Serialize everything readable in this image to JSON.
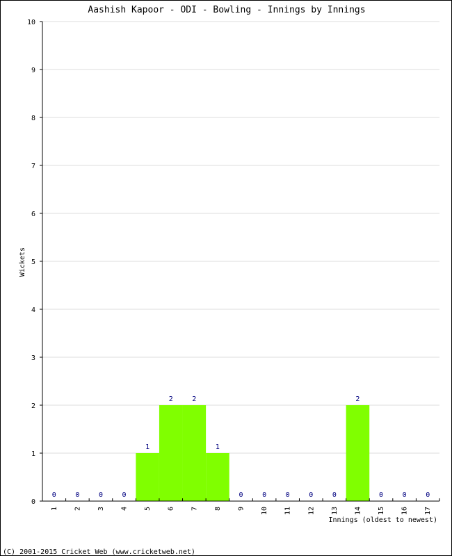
{
  "chart_data": {
    "type": "bar",
    "title": "Aashish Kapoor - ODI - Bowling - Innings by Innings",
    "xlabel": "Innings (oldest to newest)",
    "ylabel": "Wickets",
    "categories": [
      "1",
      "2",
      "3",
      "4",
      "5",
      "6",
      "7",
      "8",
      "9",
      "10",
      "11",
      "12",
      "13",
      "14",
      "15",
      "16",
      "17"
    ],
    "values": [
      0,
      0,
      0,
      0,
      1,
      2,
      2,
      1,
      0,
      0,
      0,
      0,
      0,
      2,
      0,
      0,
      0
    ],
    "ylim": [
      0,
      10
    ],
    "yticks": [
      0,
      1,
      2,
      3,
      4,
      5,
      6,
      7,
      8,
      9,
      10
    ],
    "grid": true,
    "bar_color": "#80ff00",
    "label_color": "#000080"
  },
  "footer": "(C) 2001-2015 Cricket Web (www.cricketweb.net)"
}
